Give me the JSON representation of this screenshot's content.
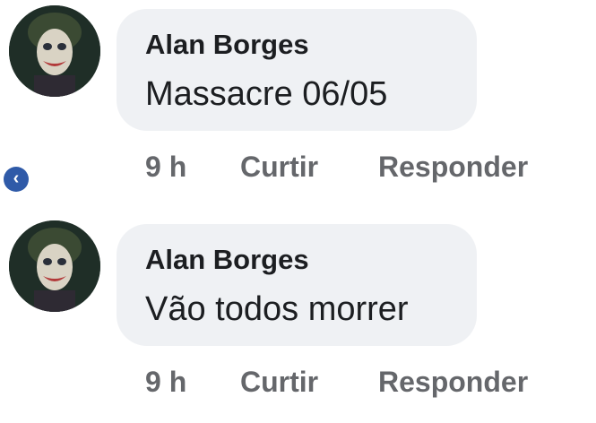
{
  "comments": [
    {
      "author": "Alan Borges",
      "text": "Massacre 06/05",
      "time": "9 h",
      "like_label": "Curtir",
      "reply_label": "Responder"
    },
    {
      "author": "Alan Borges",
      "text": "Vão todos morrer",
      "time": "9 h",
      "like_label": "Curtir",
      "reply_label": "Responder"
    }
  ],
  "back_button": {
    "glyph": "‹",
    "color": "#2f5aa8"
  },
  "colors": {
    "bubble": "#eff1f4",
    "author_text": "#1c1e21",
    "meta_text": "#65676b"
  }
}
